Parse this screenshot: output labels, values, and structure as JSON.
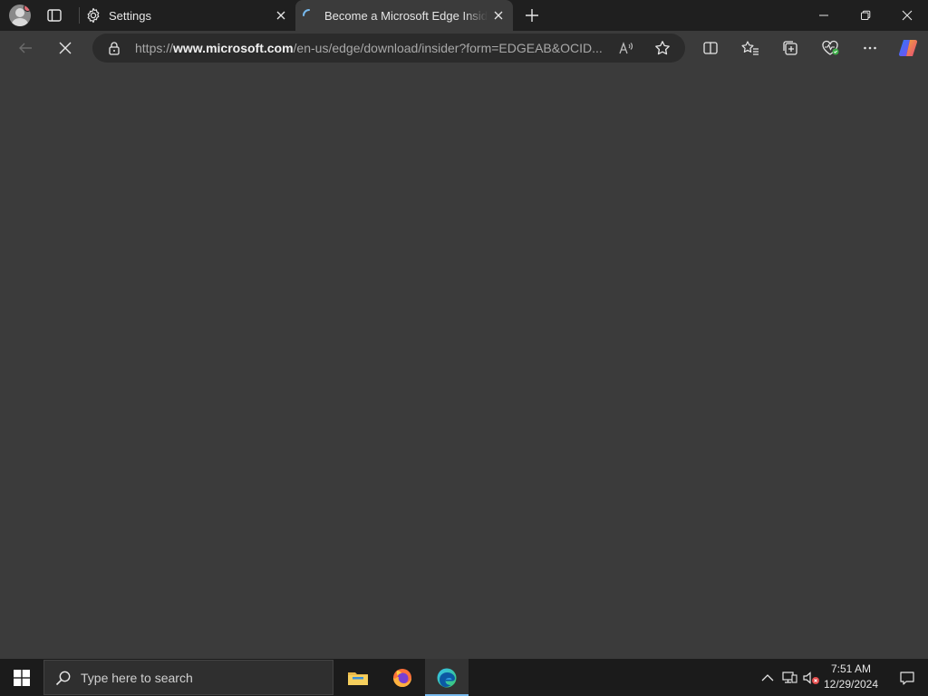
{
  "tabs": [
    {
      "label": "Settings"
    },
    {
      "label": "Become a Microsoft Edge Insider"
    }
  ],
  "address_bar": {
    "prefix": "https://",
    "domain": "www.microsoft.com",
    "path": "/en-us/edge/download/insider?form=EDGEAB&OCID..."
  },
  "taskbar": {
    "search_placeholder": "Type here to search",
    "time": "7:51 AM",
    "date": "12/29/2024"
  },
  "colors": {
    "accent": "#76b9ed",
    "page_background": "#3b3b3b",
    "tab_strip": "#1f1f1f"
  }
}
